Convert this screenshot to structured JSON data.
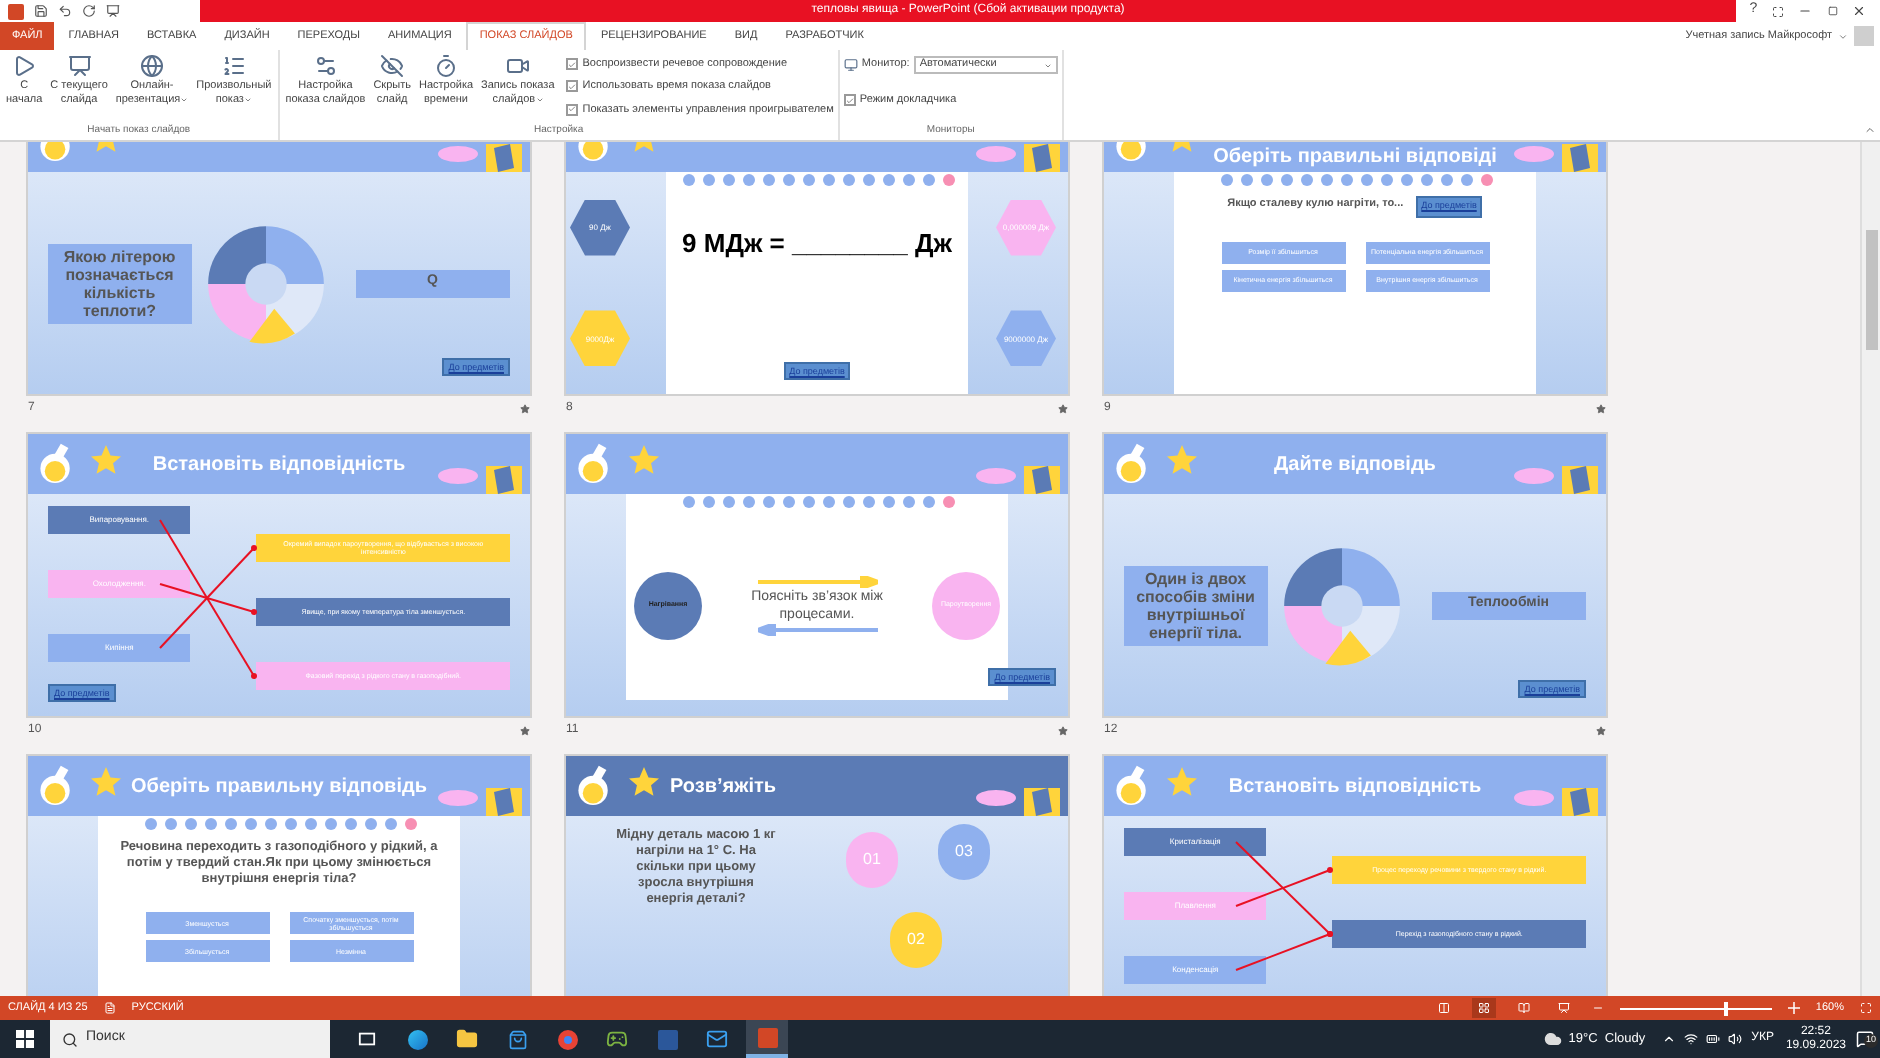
{
  "title_bar": {
    "title": "тепловы явища - PowerPoint (Сбой активации продукта)",
    "help": "?"
  },
  "tabs": [
    {
      "label": "ФАЙЛ",
      "kind": "file",
      "selected": false
    },
    {
      "label": "ГЛАВНАЯ",
      "kind": "tab",
      "selected": false
    },
    {
      "label": "ВСТАВКА",
      "kind": "tab",
      "selected": false
    },
    {
      "label": "ДИЗАЙН",
      "kind": "tab",
      "selected": false
    },
    {
      "label": "ПЕРЕХОДЫ",
      "kind": "tab",
      "selected": false
    },
    {
      "label": "АНИМАЦИЯ",
      "kind": "tab",
      "selected": false
    },
    {
      "label": "ПОКАЗ СЛАЙДОВ",
      "kind": "tab",
      "selected": true
    },
    {
      "label": "РЕЦЕНЗИРОВАНИЕ",
      "kind": "tab",
      "selected": false
    },
    {
      "label": "ВИД",
      "kind": "tab",
      "selected": false
    },
    {
      "label": "РАЗРАБОТЧИК",
      "kind": "tab",
      "selected": false
    }
  ],
  "account": "Учетная запись Майкрософт",
  "ribbon": [
    {
      "label": "Начать показ слайдов",
      "buttons": [
        {
          "lines": [
            "С",
            "начала"
          ],
          "dropdown": false
        },
        {
          "lines": [
            "С текущего",
            "слайда"
          ],
          "dropdown": false
        },
        {
          "lines": [
            "Онлайн-",
            "презентация"
          ],
          "dropdown": true
        },
        {
          "lines": [
            "Произвольный",
            "показ"
          ],
          "dropdown": true
        }
      ]
    },
    {
      "label": "Настройка",
      "buttons": [
        {
          "lines": [
            "Настройка",
            "показа слайдов"
          ],
          "dropdown": false
        },
        {
          "lines": [
            "Скрыть",
            "слайд"
          ],
          "dropdown": false
        },
        {
          "lines": [
            "Настройка",
            "времени"
          ],
          "dropdown": false
        },
        {
          "lines": [
            "Запись показа",
            "слайдов"
          ],
          "dropdown": true
        }
      ],
      "checkboxes": [
        {
          "label": "Воспроизвести речевое сопровождение",
          "checked": true
        },
        {
          "label": "Использовать время показа слайдов",
          "checked": true
        },
        {
          "label": "Показать элементы управления проигрывателем",
          "checked": true
        }
      ]
    },
    {
      "label": "Мониторы",
      "monitor_label": "Монитор:",
      "monitor_value": "Автоматически",
      "checkboxes": [
        {
          "label": "Режим докладчика",
          "checked": true
        }
      ]
    }
  ],
  "slides": [
    {
      "number": "7",
      "kind": "cycle",
      "question": "Якою літерою позначається кількість теплоти?",
      "answer": "Q",
      "button": "До предметів"
    },
    {
      "number": "8",
      "kind": "equation",
      "equation": "9 МДж = ________ Дж",
      "hexagons": [
        {
          "label": "90 Дж",
          "color": "#5b7bb5"
        },
        {
          "label": "9000Дж",
          "color": "#ffd43b"
        },
        {
          "label": "0,000009 Дж",
          "color": "#f9b4f0"
        },
        {
          "label": "9000000 Дж",
          "color": "#8fb0ee"
        }
      ],
      "button": "До предметів"
    },
    {
      "number": "9",
      "kind": "choice",
      "title": "Оберіть правильні відповіді",
      "question": "Якщо сталеву кулю нагріти, то...",
      "options": [
        "Розмір її збільшиться",
        "Потенціальна енергія збільшиться",
        "Кінетична енергія збільшиться",
        "Внутрішня енергія збільшиться"
      ],
      "button": "До предметів"
    },
    {
      "number": "10",
      "kind": "match",
      "title": "Встановіть відповідність",
      "left": [
        {
          "label": "Випаровування.",
          "color": "#5b7bb5",
          "arrow": true
        },
        {
          "label": "Охолодження.",
          "color": "#f9b4f0",
          "arrow": true
        },
        {
          "label": "Кипіння",
          "color": "#8fb0ee",
          "arrow": true
        }
      ],
      "right": [
        {
          "label": "Окремий випадок пароутворення, що відбувається з високою інтенсивністю",
          "color": "#ffd43b"
        },
        {
          "label": "Явище, при якому температура тіла зменшується.",
          "color": "#5b7bb5"
        },
        {
          "label": "Фазовий перехід з рідкого стану в газоподібний.",
          "color": "#f9b4f0"
        }
      ],
      "button": "До предметів"
    },
    {
      "number": "11",
      "kind": "relation",
      "circles": [
        {
          "label": "Нагрівання",
          "color": "#5b7bb5"
        },
        {
          "label": "Пароутворення",
          "color": "#f9b4f0"
        }
      ],
      "question": "Поясніть зв’язок між процесами.",
      "button": "До предметів"
    },
    {
      "number": "12",
      "kind": "cycle",
      "title": "Дайте відповідь",
      "question": "Один із двох способів зміни внутрішньої енергії тіла.",
      "answer": "Теплообмін",
      "button": "До предметів"
    },
    {
      "kind": "choice",
      "title": "Оберіть правильну відповідь",
      "question": "Речовина переходить з газоподібного у рідкий, а потім у твердий стан.Як при цьому змінюється внутрішня енергія тіла?",
      "options": [
        "Зменшується",
        "Спочатку зменшується, потім збільшується",
        "Збільшується",
        "Незмінна"
      ]
    },
    {
      "kind": "bulbs",
      "title": "Розв’яжіть",
      "question": "Мідну деталь масою 1 кг нагріли на 1° С. На скільки при цьому зросла внутрішня енергія деталі?",
      "bulbs": [
        {
          "label": "01",
          "color": "#f9b4f0"
        },
        {
          "label": "03",
          "color": "#8fb0ee"
        },
        {
          "label": "02",
          "color": "#ffd43b"
        }
      ]
    },
    {
      "kind": "match",
      "title": "Встановіть відповідність",
      "left": [
        {
          "label": "Кристалізація",
          "color": "#5b7bb5",
          "arrow": true
        },
        {
          "label": "Плавлення",
          "color": "#f9b4f0",
          "arrow": true
        },
        {
          "label": "Конденсація",
          "color": "#8fb0ee",
          "arrow": true
        }
      ],
      "right": [
        {
          "label": "Процес переходу речовини з твердого стану в рідкий.",
          "color": "#ffd43b"
        },
        {
          "label": "Перехід з газоподібного стану в рідкий.",
          "color": "#5b7bb5"
        }
      ]
    }
  ],
  "status_bar": {
    "slide": "СЛАЙД 4 ИЗ 25",
    "language": "РУССКИЙ",
    "views": [
      {
        "kind": "normal",
        "selected": false
      },
      {
        "kind": "sorter",
        "selected": true
      },
      {
        "kind": "reading",
        "selected": false
      },
      {
        "kind": "slideshow",
        "selected": false
      }
    ],
    "zoom": {
      "level": 0.68,
      "reading": "160%"
    }
  },
  "taskbar": {
    "search": "Поиск",
    "apps": [
      {
        "kind": "taskview",
        "selected": false
      },
      {
        "kind": "browser",
        "selected": false
      },
      {
        "kind": "folder",
        "selected": false
      },
      {
        "kind": "store",
        "selected": false
      },
      {
        "kind": "chrome",
        "selected": false
      },
      {
        "kind": "game",
        "selected": false
      },
      {
        "kind": "document",
        "selected": false
      },
      {
        "kind": "mail",
        "selected": false
      },
      {
        "kind": "presentation",
        "selected": true
      }
    ],
    "weather": "19°C  Cloudy",
    "language": "УКР",
    "time": "22:52",
    "date": "19.09.2023",
    "notifications": "10"
  }
}
